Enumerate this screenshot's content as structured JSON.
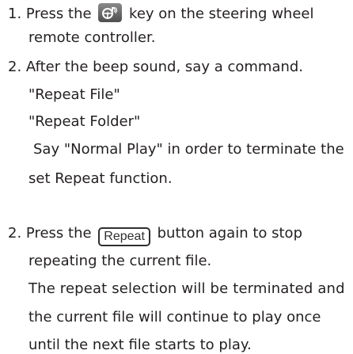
{
  "steps": {
    "step1": {
      "number": "1.",
      "before_icon": "Press the",
      "icon": "steering-wheel-voice-key-icon",
      "after_icon": "key on the steering wheel",
      "continuation": "remote controller."
    },
    "step2": {
      "number": "2.",
      "text": "After the beep sound, say a command.",
      "commands": [
        "\"Repeat File\"",
        "\"Repeat Folder\""
      ],
      "note_line1": "Say \"Normal Play\" in order to terminate the",
      "note_line2": "set Repeat function."
    },
    "step2b": {
      "number": "2.",
      "before_button": "Press the",
      "button_label": "Repeat",
      "after_button": "button again to stop",
      "continuation": "repeating the current file.",
      "result_line1": "The repeat selection will be terminated and",
      "result_line2": "the current file will continue to play once",
      "result_line3": "until the next file starts to play."
    }
  }
}
